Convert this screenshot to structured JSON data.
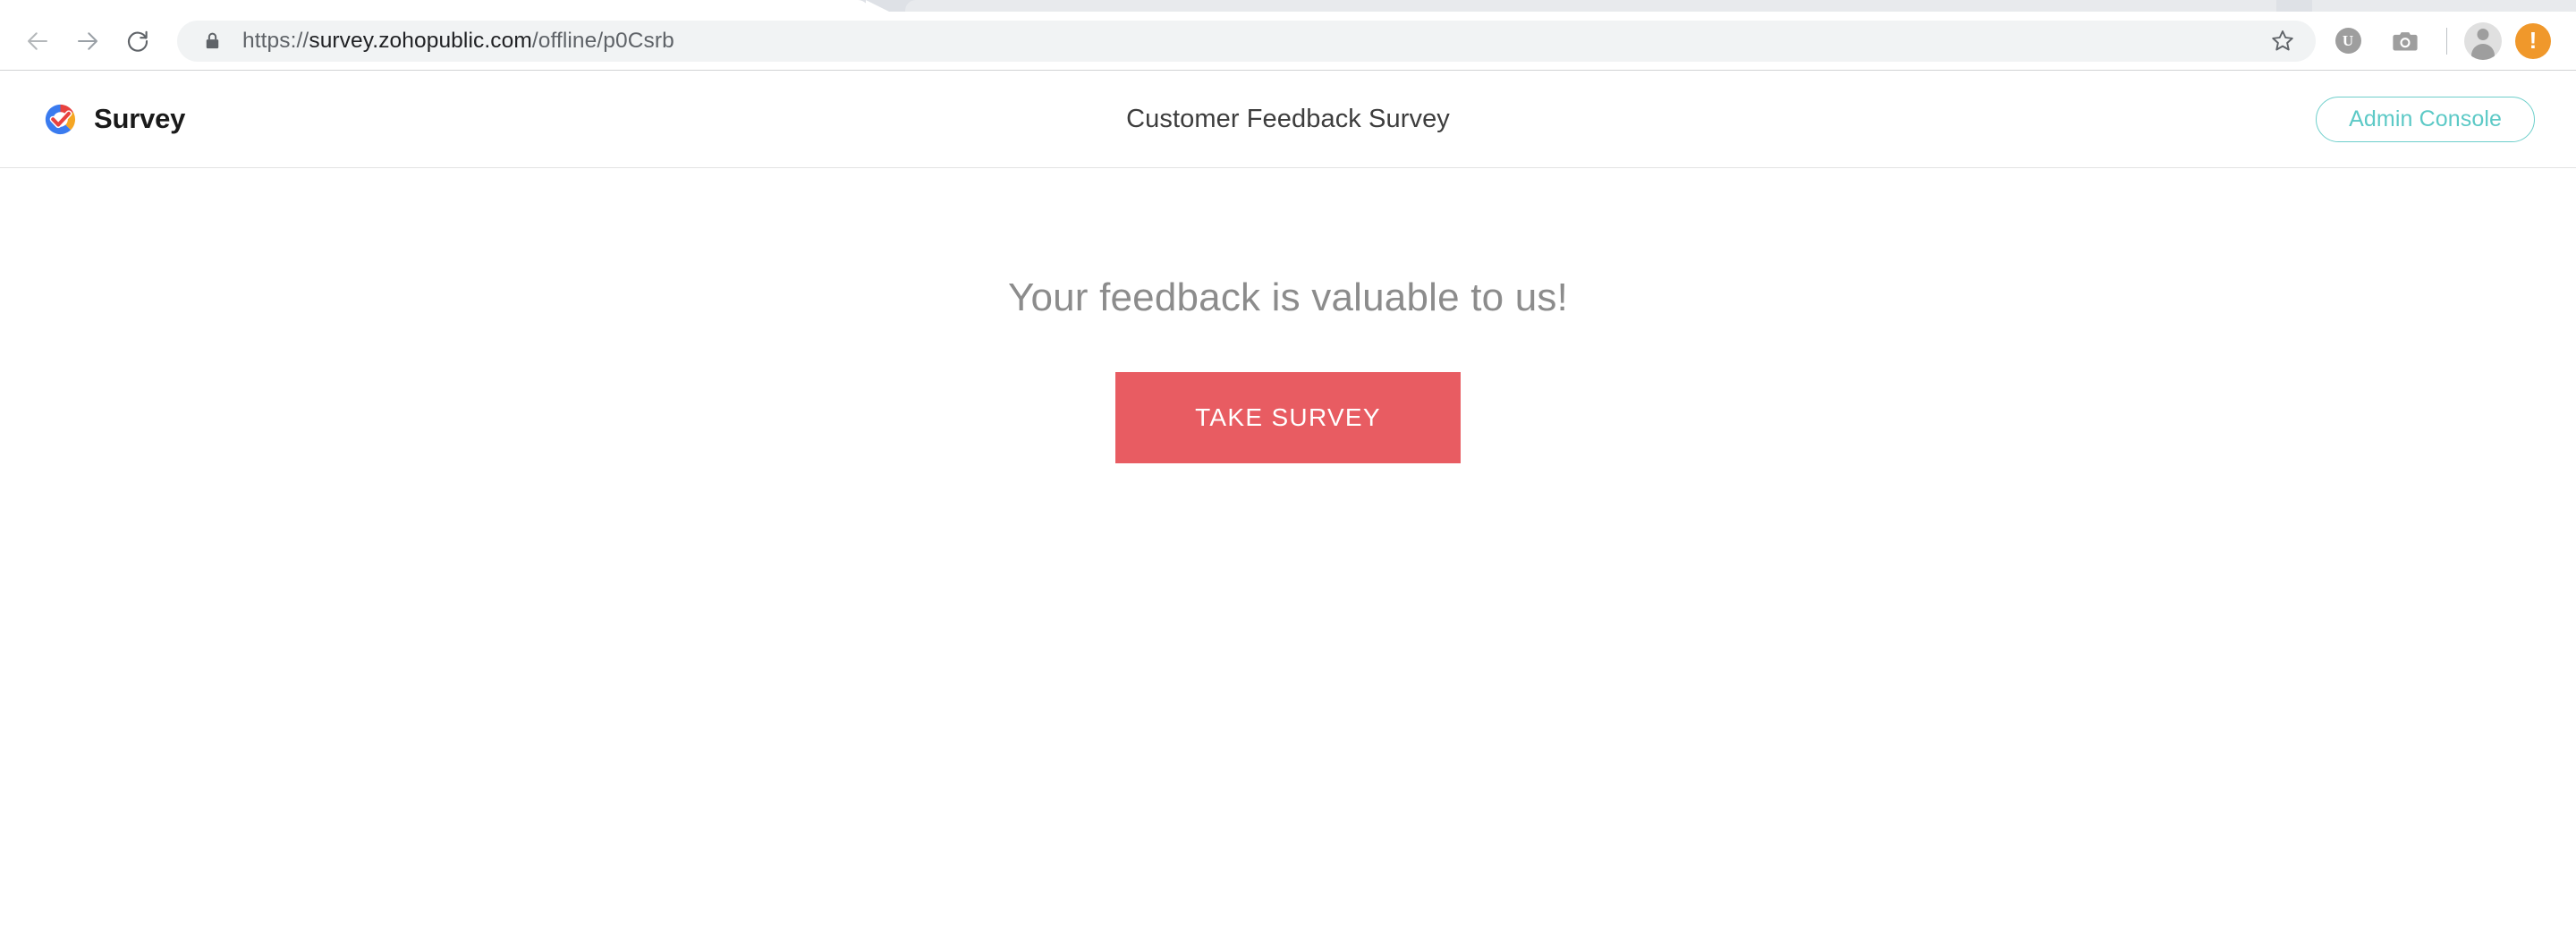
{
  "browser": {
    "nav": {
      "back_icon": "arrow-left-icon",
      "forward_icon": "arrow-right-icon",
      "reload_icon": "reload-icon"
    },
    "omnibox": {
      "lock_icon": "lock-icon",
      "url_scheme": "https://",
      "url_host": "survey.zohopublic.com",
      "url_path": "/offline/p0Csrb",
      "full_url": "https://survey.zohopublic.com/offline/p0Csrb",
      "bookmark_icon": "star-icon"
    },
    "extensions": [
      {
        "name": "u-extension-icon",
        "label": "U"
      },
      {
        "name": "camera-extension-icon",
        "label": ""
      }
    ],
    "profile": {
      "icon": "person-avatar-icon"
    },
    "alert": {
      "icon": "alert-exclamation-icon",
      "label": "!"
    }
  },
  "site": {
    "brand": {
      "logo_icon": "zoho-survey-logo-icon",
      "name": "Survey"
    },
    "title": "Customer Feedback Survey",
    "admin_button": "Admin Console",
    "accent_teal": "#5cc9c6"
  },
  "main": {
    "tagline": "Your feedback is valuable to us!",
    "cta_label": "TAKE SURVEY",
    "cta_color": "#e85c62"
  }
}
